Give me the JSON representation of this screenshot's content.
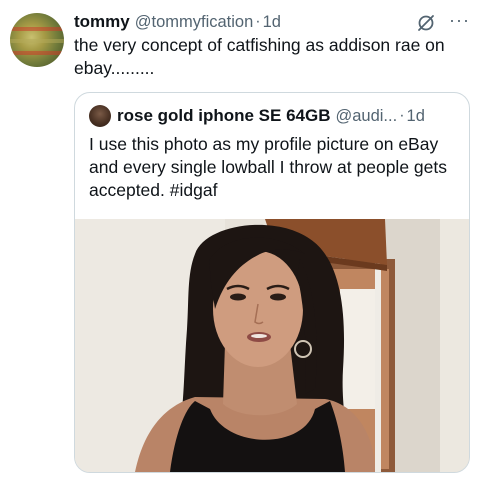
{
  "tweet": {
    "author_name": "tommy",
    "author_handle": "@tommyfication",
    "separator": "·",
    "time": "1d",
    "more_label": "···",
    "text": "the very concept of catfishing as addison rae on ebay........."
  },
  "quoted_tweet": {
    "author_name": "rose gold iphone SE 64GB",
    "author_handle": "@audi...",
    "separator": "·",
    "time": "1d",
    "text": "I use this photo as my profile picture on eBay and every single lowball I throw at people gets accepted. #idgaf"
  },
  "colors": {
    "text_primary": "#0f1419",
    "text_secondary": "#536471",
    "border": "#cfd9de"
  }
}
